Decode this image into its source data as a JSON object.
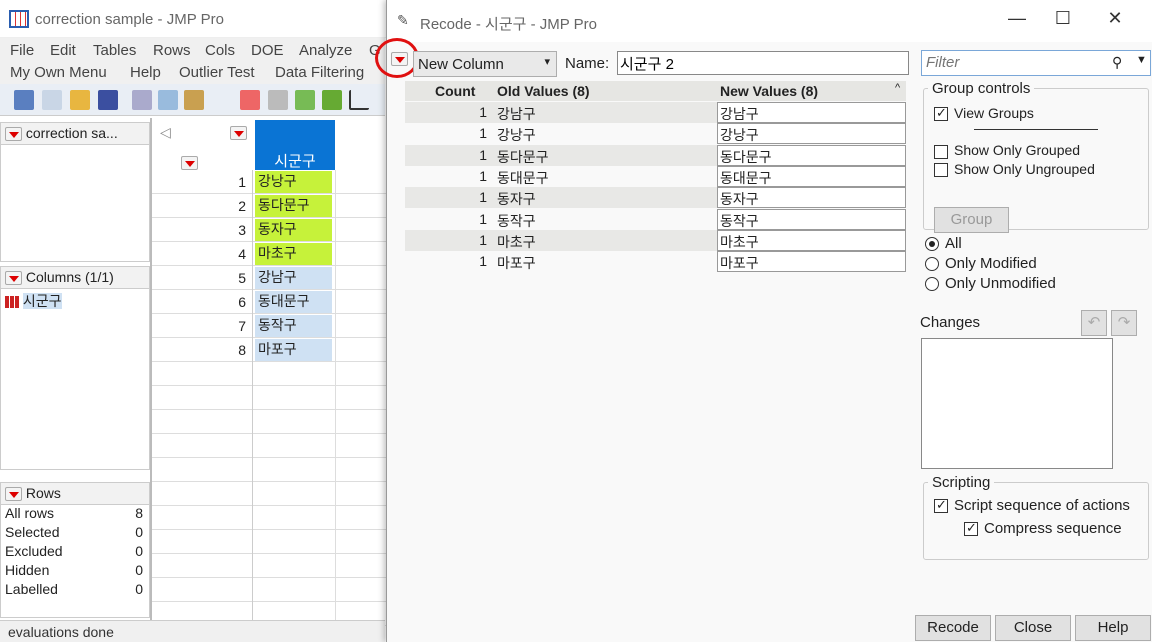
{
  "main_window": {
    "title": "correction sample - JMP Pro",
    "menu": [
      "File",
      "Edit",
      "Tables",
      "Rows",
      "Cols",
      "DOE",
      "Analyze",
      "G",
      "My Own Menu",
      "Help",
      "Outlier Test",
      "Data Filtering"
    ],
    "table_panel": "correction sa...",
    "columns_panel": {
      "header": "Columns (1/1)",
      "items": [
        "시군구"
      ]
    },
    "rows_panel": {
      "header": "Rows",
      "items": [
        {
          "label": "All rows",
          "value": "8"
        },
        {
          "label": "Selected",
          "value": "0"
        },
        {
          "label": "Excluded",
          "value": "0"
        },
        {
          "label": "Hidden",
          "value": "0"
        },
        {
          "label": "Labelled",
          "value": "0"
        }
      ]
    },
    "column_header": "시군구",
    "rows": [
      {
        "n": "1",
        "v": "강낭구",
        "hl": true
      },
      {
        "n": "2",
        "v": "동다문구",
        "hl": true
      },
      {
        "n": "3",
        "v": "동자구",
        "hl": true
      },
      {
        "n": "4",
        "v": "마초구",
        "hl": true
      },
      {
        "n": "5",
        "v": "강남구",
        "hl": false
      },
      {
        "n": "6",
        "v": "동대문구",
        "hl": false
      },
      {
        "n": "7",
        "v": "동작구",
        "hl": false
      },
      {
        "n": "8",
        "v": "마포구",
        "hl": false
      }
    ],
    "status": "evaluations done",
    "colors": {
      "highlight": "#c6f23a",
      "selected": "#cfe1f3",
      "header": "#0a74d4"
    }
  },
  "dialog": {
    "title": "Recode - 시군구 - JMP Pro",
    "mode": "New Column",
    "name_label": "Name:",
    "name_value": "시군구 2",
    "filter_placeholder": "Filter",
    "table": {
      "headers": {
        "count": "Count",
        "old": "Old Values (8)",
        "new": "New Values (8)"
      },
      "rows": [
        [
          "1",
          "강남구",
          "강남구"
        ],
        [
          "1",
          "강낭구",
          "강낭구"
        ],
        [
          "1",
          "동다문구",
          "동다문구"
        ],
        [
          "1",
          "동대문구",
          "동대문구"
        ],
        [
          "1",
          "동자구",
          "동자구"
        ],
        [
          "1",
          "동작구",
          "동작구"
        ],
        [
          "1",
          "마초구",
          "마초구"
        ],
        [
          "1",
          "마포구",
          "마포구"
        ]
      ]
    },
    "group_controls": {
      "legend": "Group controls",
      "view_groups": "View Groups",
      "show_grouped": "Show Only Grouped",
      "show_ungrouped": "Show Only Ungrouped",
      "group_btn": "Group"
    },
    "filter_radios": [
      "All",
      "Only Modified",
      "Only Unmodified"
    ],
    "changes_label": "Changes",
    "scripting": {
      "legend": "Scripting",
      "script_seq": "Script sequence of actions",
      "compress": "Compress sequence"
    },
    "buttons": {
      "recode": "Recode",
      "close": "Close",
      "help": "Help"
    }
  }
}
